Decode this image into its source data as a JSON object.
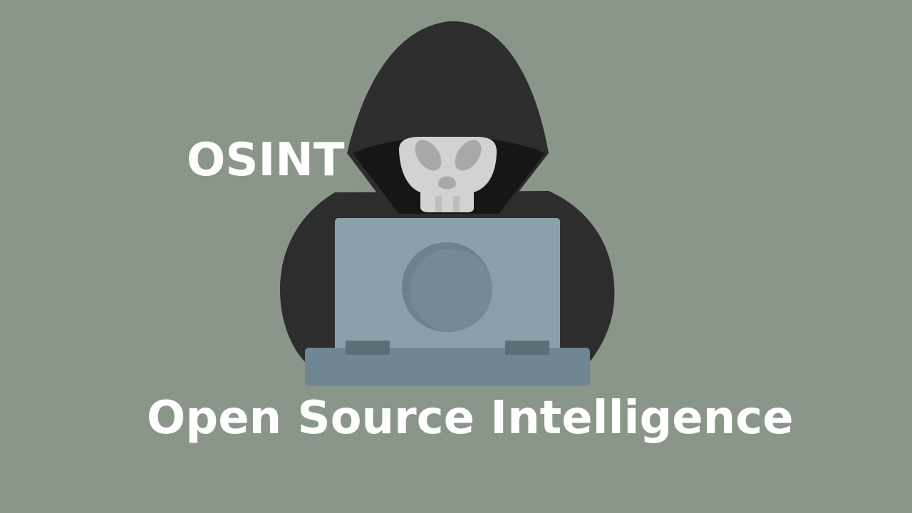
{
  "heading": {
    "abbreviation": "OSINT",
    "full_name": "Open Source Intelligence"
  },
  "illustration": {
    "subject": "hooded-hacker-with-laptop-icon",
    "skull": "skull-icon",
    "laptop": "laptop-icon"
  },
  "colors": {
    "background": "#8b968a",
    "hood": "#2d2d2d",
    "hood_inner": "#161616",
    "skull": "#d2d2d2",
    "skull_features": "#a8a8a8",
    "laptop_screen": "#8aa1ab",
    "laptop_base": "#6f8793",
    "text": "#ffffff"
  }
}
